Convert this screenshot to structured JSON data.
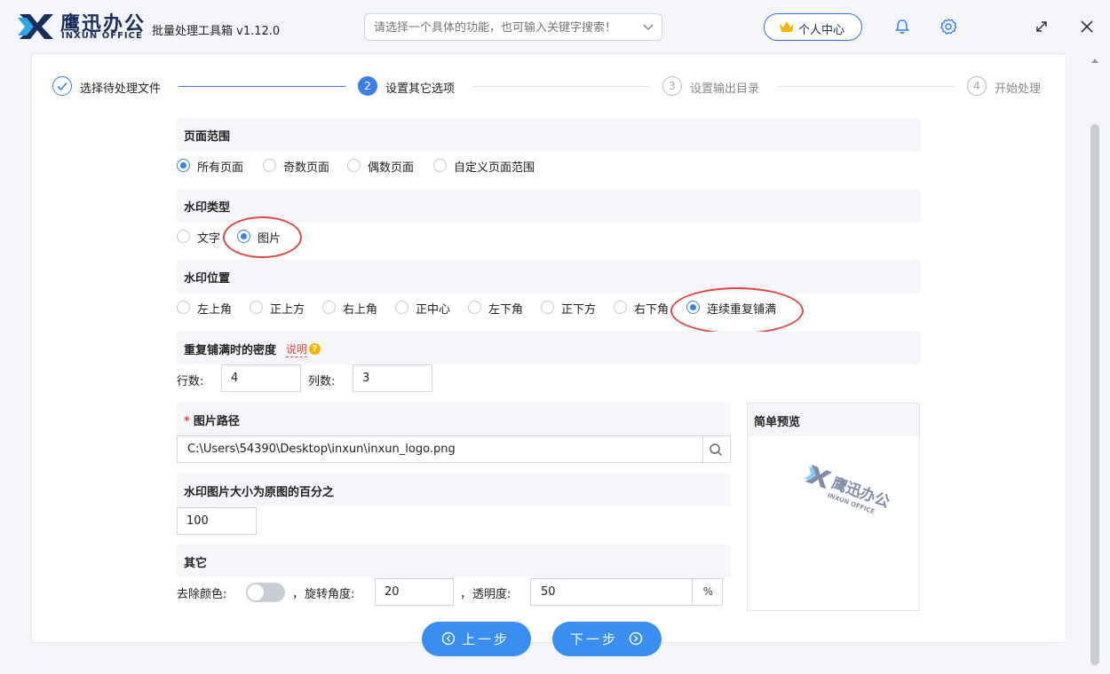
{
  "app": {
    "brand_cn": "鹰迅办公",
    "brand_en": "INXUN OFFICE",
    "title": "批量处理工具箱 v1.12.0",
    "search_placeholder": "请选择一个具体的功能，也可输入关键字搜索！",
    "user_center": "个人中心"
  },
  "steps": [
    {
      "num": "✓",
      "label": "选择待处理文件",
      "state": "done"
    },
    {
      "num": "2",
      "label": "设置其它选项",
      "state": "active"
    },
    {
      "num": "3",
      "label": "设置输出目录",
      "state": "pending"
    },
    {
      "num": "4",
      "label": "开始处理",
      "state": "pending"
    }
  ],
  "page_range": {
    "title": "页面范围",
    "options": [
      "所有页面",
      "奇数页面",
      "偶数页面",
      "自定义页面范围"
    ],
    "selected": 0
  },
  "watermark_type": {
    "title": "水印类型",
    "options": [
      "文字",
      "图片"
    ],
    "selected": 1
  },
  "watermark_position": {
    "title": "水印位置",
    "options": [
      "左上角",
      "正上方",
      "右上角",
      "正中心",
      "左下角",
      "正下方",
      "右下角",
      "连续重复铺满"
    ],
    "selected": 7
  },
  "density": {
    "title": "重复铺满时的密度",
    "help": "说明",
    "rows_label": "行数:",
    "rows_value": "4",
    "cols_label": "列数:",
    "cols_value": "3"
  },
  "image_path": {
    "required": "*",
    "title": "图片路径",
    "value": "C:\\Users\\54390\\Desktop\\inxun\\inxun_logo.png"
  },
  "image_size": {
    "title": "水印图片大小为原图的百分之",
    "value": "100"
  },
  "other": {
    "title": "其它",
    "remove_color_label": "去除颜色:",
    "remove_color_on": false,
    "rotation_label": "旋转角度:",
    "rotation_value": "20",
    "opacity_label": "透明度:",
    "opacity_value": "50",
    "opacity_unit": "%",
    "sep": "，"
  },
  "preview": {
    "title": "简单预览",
    "wm_cn": "鹰迅办公",
    "wm_en": "INXUN OFFICE"
  },
  "nav": {
    "prev": "上一步",
    "next": "下一步"
  },
  "colors": {
    "accent": "#3a7ee8",
    "button": "#3a8ef2",
    "highlight_ring": "#e04848"
  }
}
